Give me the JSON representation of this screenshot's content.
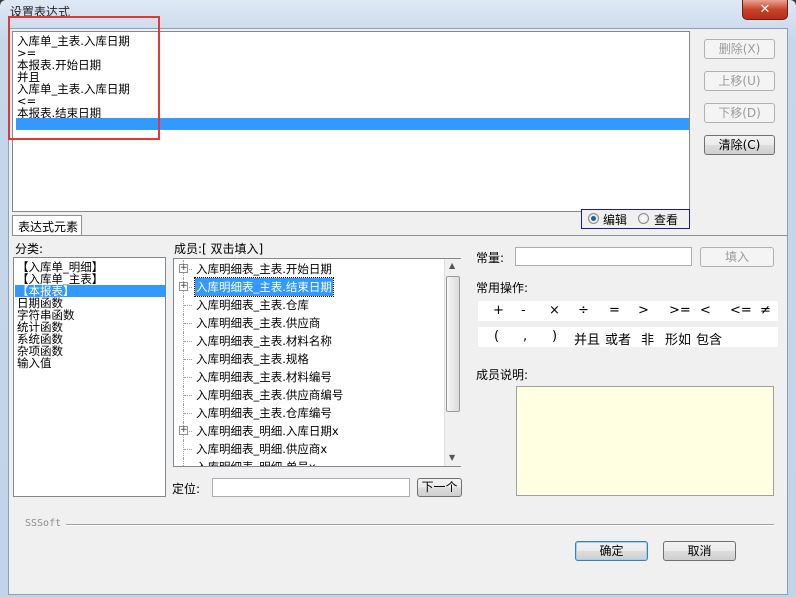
{
  "window": {
    "title": "设置表达式",
    "close_glyph": "✕"
  },
  "expression": {
    "lines": [
      "入库单_主表.入库日期",
      ">=",
      "本报表.开始日期",
      "并且",
      "入库单_主表.入库日期",
      "<=",
      "本报表.结束日期"
    ]
  },
  "side_buttons": {
    "delete": "删除(X)",
    "move_up": "上移(U)",
    "move_down": "下移(D)",
    "clear": "清除(C)"
  },
  "tab": {
    "label": "表达式元素"
  },
  "mode": {
    "edit": "编辑",
    "view": "查看",
    "selected": "编辑"
  },
  "category": {
    "label": "分类:",
    "items": [
      "【入库单_明细】",
      "【入库单_主表】",
      "【本报表】",
      "日期函数",
      "字符串函数",
      "统计函数",
      "系统函数",
      "杂项函数",
      "输入值"
    ],
    "selected_index": 2
  },
  "members": {
    "label": "成员:[ 双击填入]",
    "items": [
      {
        "text": "入库明细表_主表.开始日期",
        "expandable": true
      },
      {
        "text": "入库明细表_主表.结束日期",
        "expandable": true,
        "selected": true
      },
      {
        "text": "入库明细表_主表.仓库",
        "expandable": false
      },
      {
        "text": "入库明细表_主表.供应商",
        "expandable": false
      },
      {
        "text": "入库明细表_主表.材料名称",
        "expandable": false
      },
      {
        "text": "入库明细表_主表.规格",
        "expandable": false
      },
      {
        "text": "入库明细表_主表.材料编号",
        "expandable": false
      },
      {
        "text": "入库明细表_主表.供应商编号",
        "expandable": false
      },
      {
        "text": "入库明细表_主表.仓库编号",
        "expandable": false
      },
      {
        "text": "入库明细表_明细.入库日期x",
        "expandable": true
      },
      {
        "text": "入库明细表_明细.供应商x",
        "expandable": false
      },
      {
        "text": "入库明细表_明细.单号x",
        "expandable": false
      }
    ]
  },
  "constant": {
    "label": "常量:",
    "value": "",
    "fill_button": "填入"
  },
  "operators": {
    "label": "常用操作:",
    "row1": [
      "+",
      "-",
      "×",
      "÷",
      "=",
      ">",
      ">=",
      "<",
      "<=",
      "≠"
    ],
    "row2": [
      "(",
      ",",
      ")",
      "并且",
      "或者",
      "非",
      "形如",
      "包含"
    ]
  },
  "member_desc": {
    "label": "成员说明:",
    "value": ""
  },
  "locate": {
    "label": "定位:",
    "value": "",
    "next_button": "下一个"
  },
  "footer": {
    "brand": "SSSoft",
    "ok": "确定",
    "cancel": "取消"
  }
}
